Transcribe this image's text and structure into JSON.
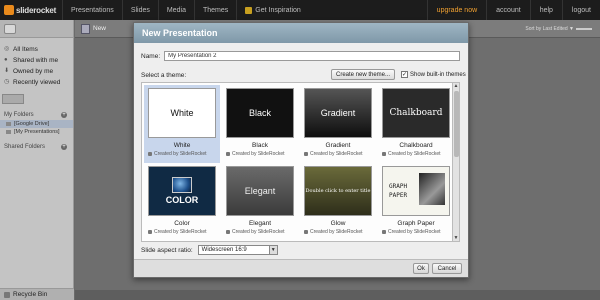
{
  "app": {
    "logo_text": "sliderocket"
  },
  "topnav": {
    "items": [
      "Presentations",
      "Slides",
      "Media",
      "Themes",
      "Get Inspiration"
    ],
    "right": [
      "upgrade now",
      "account",
      "help",
      "logout"
    ],
    "accent": "#f0a030"
  },
  "sidebar": {
    "items": [
      {
        "label": "All Items",
        "icon": "all-items-icon"
      },
      {
        "label": "Shared with me",
        "icon": "shared-icon"
      },
      {
        "label": "Owned by me",
        "icon": "owned-icon"
      },
      {
        "label": "Recently viewed",
        "icon": "recent-icon"
      }
    ],
    "my_folders": "My Folders",
    "folders": [
      "[Google Drive]",
      "[My Presentations]"
    ],
    "shared_folders": "Shared Folders",
    "recycle": "Recycle Bin"
  },
  "toolbar": {
    "new_label": "New",
    "sort_label": "Sort by Last Edited ▼"
  },
  "dialog": {
    "title": "New Presentation",
    "name_label": "Name:",
    "name_value": "My Presentation 2",
    "theme_label": "Select a theme:",
    "create_theme": "Create new theme...",
    "show_builtin": "Show built-in themes",
    "show_builtin_checked": "✓",
    "themes": [
      {
        "name": "White",
        "thumb": "White",
        "by": "Created by SlideRocket",
        "selected": true
      },
      {
        "name": "Black",
        "thumb": "Black",
        "by": "Created by SlideRocket"
      },
      {
        "name": "Gradient",
        "thumb": "Gradient",
        "by": "Created by SlideRocket"
      },
      {
        "name": "Chalkboard",
        "thumb": "Chalkboard",
        "by": "Created by SlideRocket"
      },
      {
        "name": "Color",
        "thumb": "COLOR",
        "by": "Created by SlideRocket"
      },
      {
        "name": "Elegant",
        "thumb": "Elegant",
        "by": "Created by SlideRocket"
      },
      {
        "name": "Glow",
        "thumb": "Double click to enter title",
        "by": "Created by SlideRocket"
      },
      {
        "name": "Graph Paper",
        "thumb": "GRAPH PAPER",
        "by": "Created by SlideRocket"
      }
    ],
    "aspect_label": "Slide aspect ratio:",
    "aspect_value": "Widescreen 16:9",
    "ok": "Ok",
    "cancel": "Cancel"
  }
}
